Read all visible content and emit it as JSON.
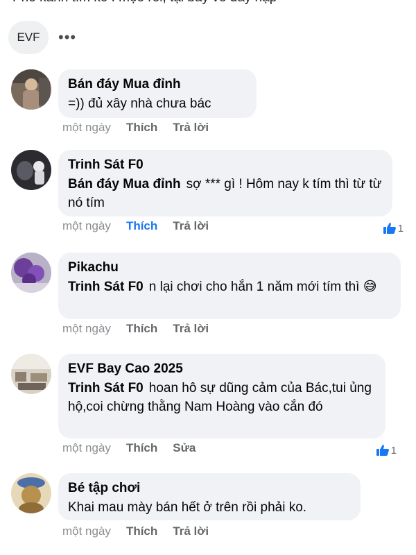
{
  "partial_text": "Phó kanh tìm ko : mẹo rồi, tại bây về đầy nạp",
  "post_author_chip": "EVF",
  "more_icon": "•••",
  "comments": [
    {
      "author": "Bán đáy Mua đỉnh",
      "mention": "",
      "text": "=)) đủ xây nhà chưa bác",
      "time": "một ngày",
      "like_label": "Thích",
      "second_action": "Trả lời",
      "liked": false,
      "like_count": ""
    },
    {
      "author": "Trinh Sát F0",
      "mention": "Bán đáy Mua đỉnh",
      "text": "sợ *** gì ! Hôm nay k tím thì từ từ nó tím",
      "time": "một ngày",
      "like_label": "Thích",
      "second_action": "Trả lời",
      "liked": true,
      "like_count": "1"
    },
    {
      "author": "Pikachu",
      "mention": "Trinh Sát F0",
      "text": "n lại chơi cho hắn 1 năm mới tím thì 😅",
      "time": "một ngày",
      "like_label": "Thích",
      "second_action": "Trả lời",
      "liked": false,
      "like_count": ""
    },
    {
      "author": "EVF Bay Cao 2025",
      "mention": "Trinh Sát F0",
      "text": "hoan hô sự dũng cảm của Bác,tui ủng hộ,coi chừng thằng Nam Hoàng vào cắn đó",
      "time": "một ngày",
      "like_label": "Thích",
      "second_action": "Sửa",
      "liked": false,
      "like_count": "1"
    },
    {
      "author": "Bé tập chơi",
      "mention": "",
      "text": "Khai mau mày bán hết ở trên rồi phải ko.",
      "time": "một ngày",
      "like_label": "Thích",
      "second_action": "Trả lời",
      "liked": false,
      "like_count": ""
    }
  ],
  "colors": {
    "bubble": "#f0f2f5",
    "liked_blue": "#1877f2",
    "meta_gray": "#8a8d91"
  },
  "icons": [
    "like-thumb-icon",
    "more-options-icon",
    "laugh-sweat-emoji"
  ]
}
